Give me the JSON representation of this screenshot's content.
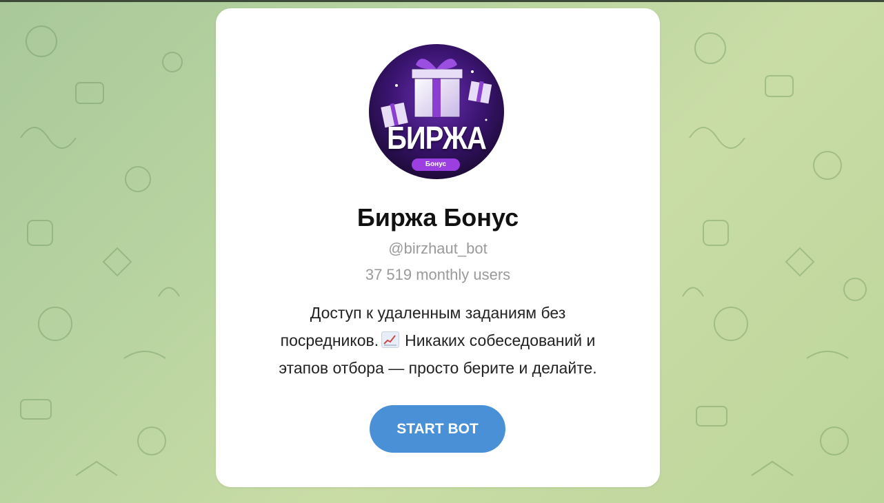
{
  "bot": {
    "avatar_logo_text": "БИРЖА",
    "avatar_pill_text": "Бонус",
    "name": "Биржа Бонус",
    "username": "@birzhaut_bot",
    "monthly_users": "37 519 monthly users",
    "description_lines": [
      "Доступ к удаленным заданиям без",
      "посредников.",
      "Никаких собеседований и",
      "этапов отбора — просто берите и делайте."
    ],
    "description_emoji": "chart-increasing-icon",
    "start_button_label": "START BOT"
  },
  "colors": {
    "background": "#b7d3a0",
    "card": "#ffffff",
    "button": "#4a90d6",
    "secondary_text": "#9a9a9a",
    "avatar_purple": "#6a2fb0"
  }
}
